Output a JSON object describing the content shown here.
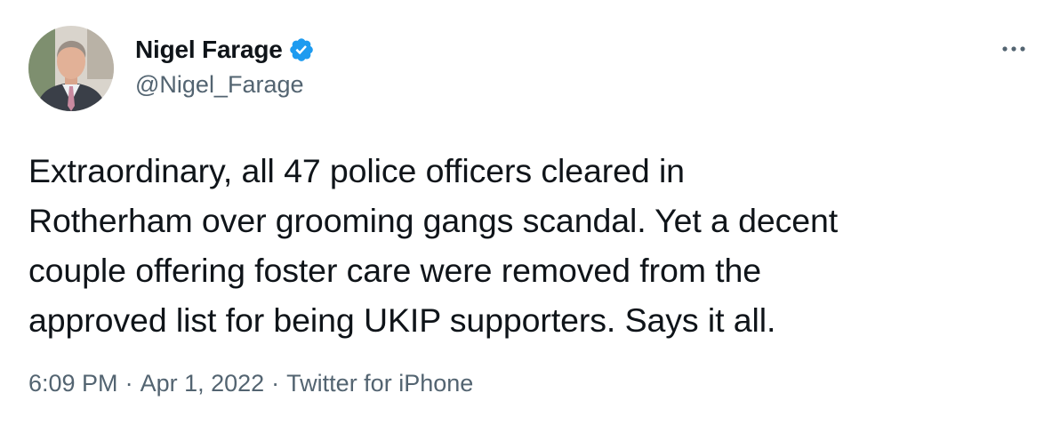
{
  "author": {
    "display_name": "Nigel Farage",
    "handle": "@Nigel_Farage",
    "verified": true
  },
  "tweet": {
    "text": "Extraordinary, all 47 police officers cleared in\nRotherham over grooming gangs scandal. Yet a decent\ncouple offering foster care were removed from the\napproved list for being UKIP supporters. Says it all."
  },
  "meta": {
    "time": "6:09 PM",
    "separator": "·",
    "date": "Apr 1, 2022",
    "source": "Twitter for iPhone"
  },
  "icons": {
    "verified": "verified-badge-icon",
    "more": "more-options-icon"
  },
  "colors": {
    "text": "#0f1419",
    "secondary": "#536471",
    "verified_blue": "#1d9bf0"
  }
}
